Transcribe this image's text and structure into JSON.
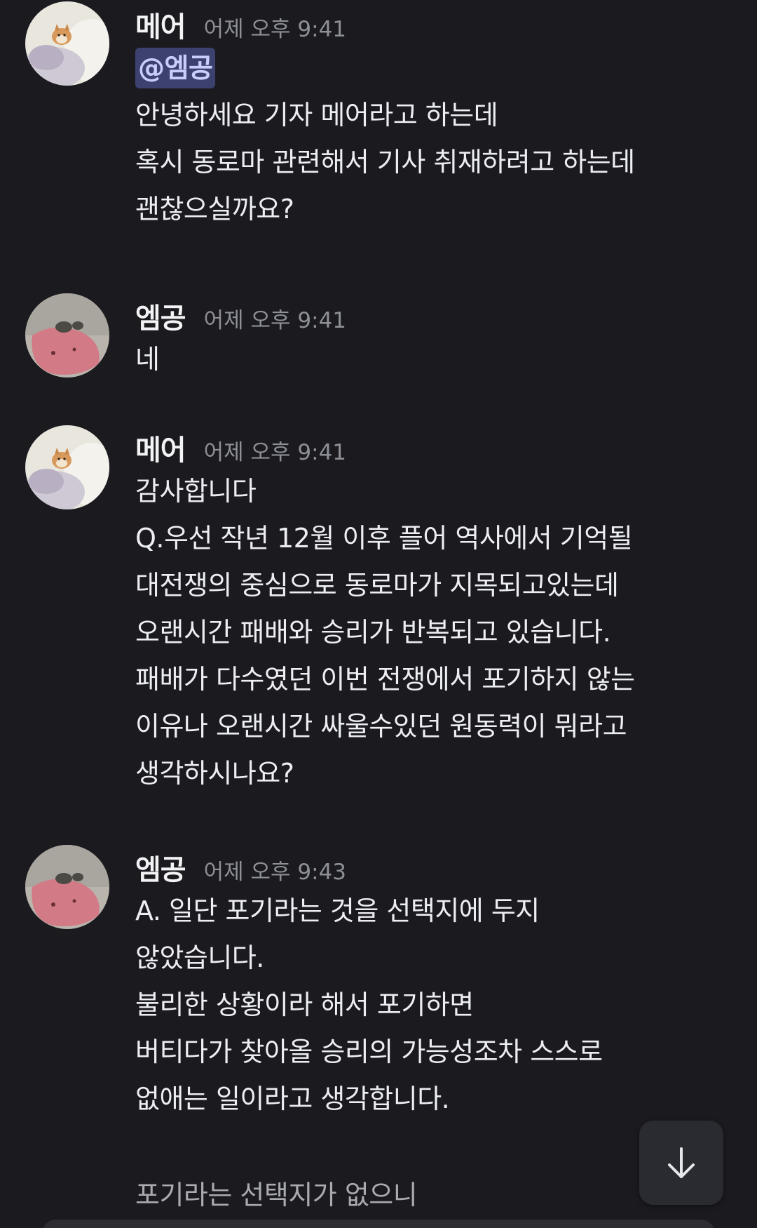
{
  "messages": [
    {
      "username": "메어",
      "timestamp": "어제 오후 9:41",
      "mention": "@엠공",
      "lines": [
        "안녕하세요 기자 메어라고 하는데",
        "혹시 동로마 관련해서 기사 취재하려고 하는데",
        "괜찮으실까요?"
      ]
    },
    {
      "username": "엠공",
      "timestamp": "어제 오후 9:41",
      "lines": [
        "네"
      ]
    },
    {
      "username": "메어",
      "timestamp": "어제 오후 9:41",
      "lines": [
        "감사합니다",
        "Q.우선 작년 12월 이후 플어 역사에서 기억될",
        "대전쟁의 중심으로 동로마가 지목되고있는데",
        "오랜시간 패배와 승리가 반복되고 있습니다.",
        "패배가 다수였던 이번 전쟁에서 포기하지 않는",
        "이유나 오랜시간 싸울수있던 원동력이 뭐라고",
        "생각하시나요?"
      ]
    },
    {
      "username": "엠공",
      "timestamp": "어제 오후 9:43",
      "lines": [
        "A. 일단 포기라는 것을 선택지에 두지",
        "않았습니다.",
        "불리한 상황이라 해서 포기하면",
        "버티다가 찾아올 승리의 가능성조차 스스로",
        "없애는 일이라고 생각합니다."
      ],
      "trailing": "포기라는 선택지가 없으니"
    }
  ],
  "colors": {
    "background": "#1a1a1f",
    "mention_bg": "#3d4170",
    "mention_text": "#c9cdfb",
    "timestamp": "#8e9097"
  },
  "icons": {
    "jump_button": "arrow-down-icon",
    "avatar_meo": "shiba-dog-avatar",
    "avatar_emgong": "pink-character-avatar"
  }
}
